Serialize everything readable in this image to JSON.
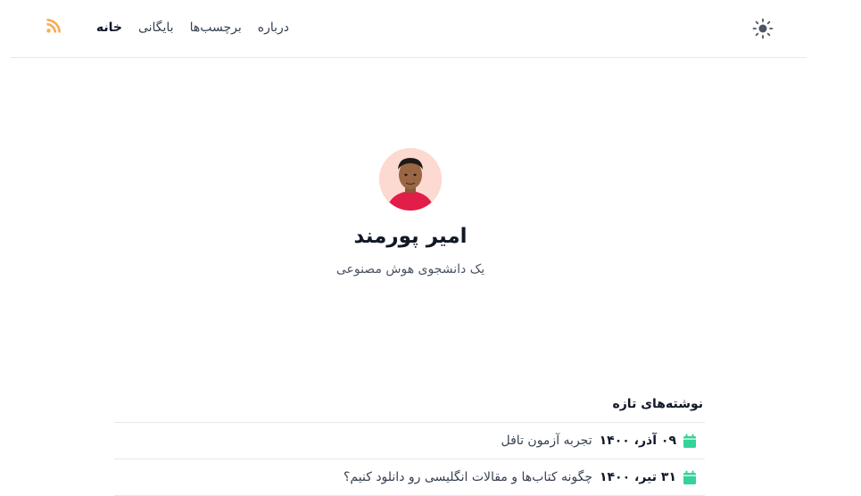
{
  "nav": {
    "home": "خانه",
    "archive": "بایگانی",
    "tags": "برچسب‌ها",
    "about": "درباره"
  },
  "icons": {
    "theme": "sun-icon",
    "rss": "rss-icon",
    "calendar": "calendar-icon"
  },
  "colors": {
    "rss": "#f6ad55",
    "calendar": "#34d399",
    "avatar_bg": "#fcd9d1"
  },
  "profile": {
    "name": "امیر پورمند",
    "bio": "یک دانشجوی هوش مصنوعی"
  },
  "recent": {
    "title": "نوشته‌های تازه",
    "posts": [
      {
        "date": "۰۹ آذر، ۱۴۰۰",
        "title": "تجربه آزمون تافل"
      },
      {
        "date": "۳۱ تیر، ۱۴۰۰",
        "title": "چگونه کتاب‌ها و مقالات انگلیسی رو دانلود کنیم؟"
      }
    ]
  }
}
